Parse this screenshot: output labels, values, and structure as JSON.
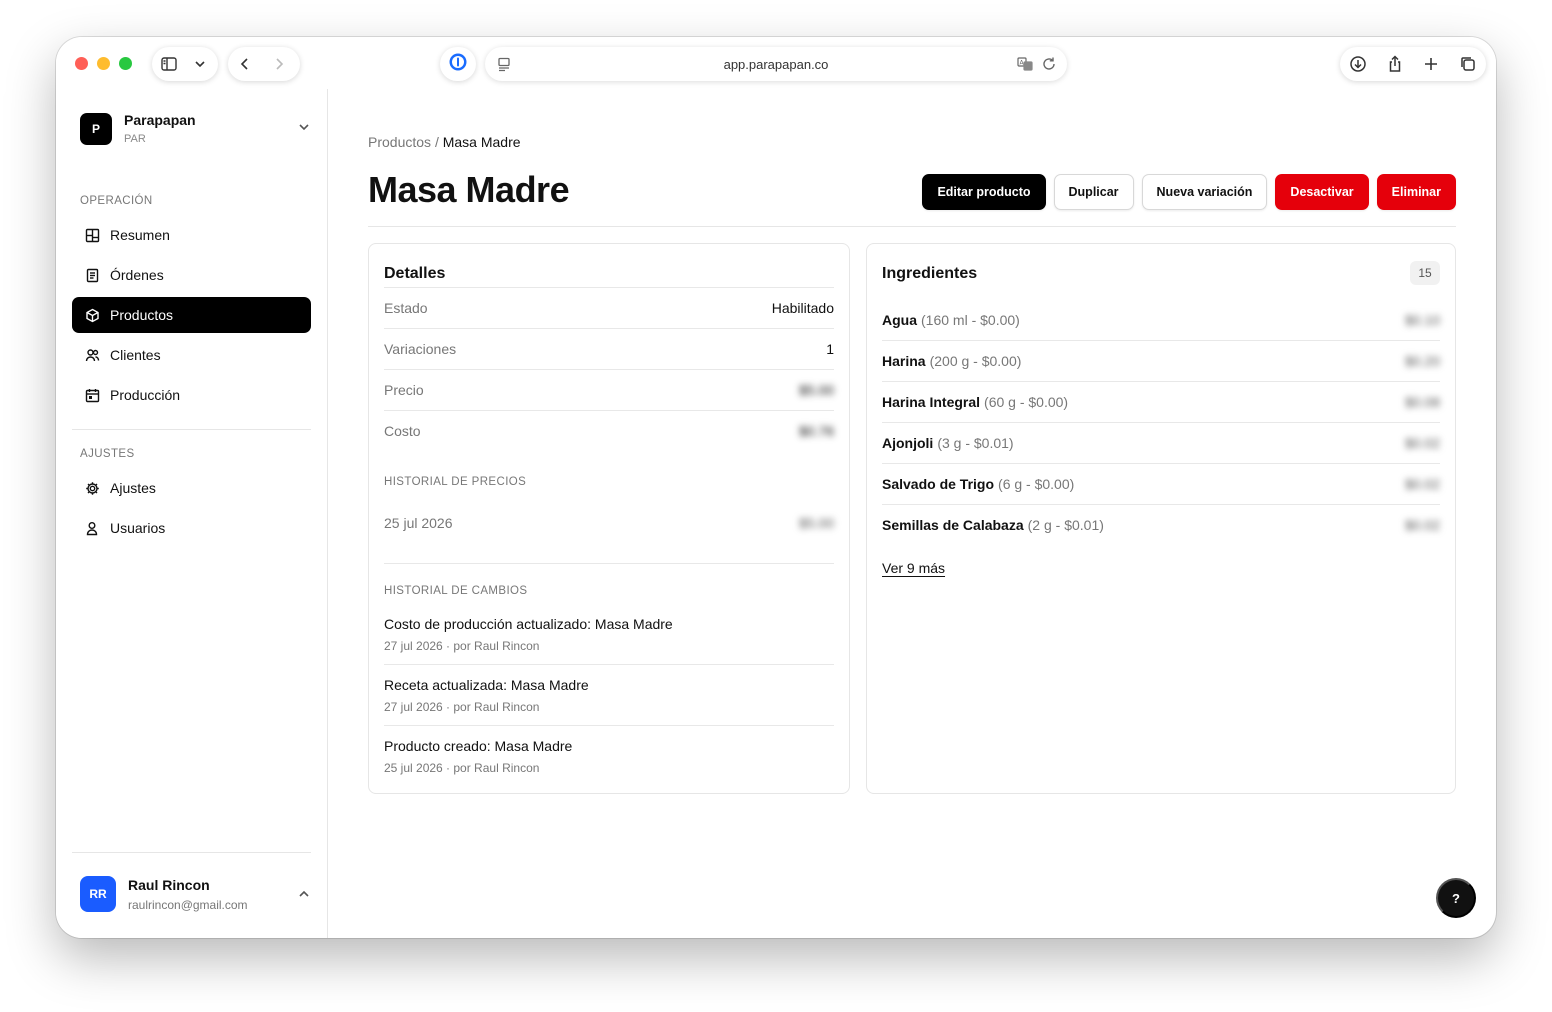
{
  "browser": {
    "url": "app.parapapan.co"
  },
  "sidebar": {
    "org": {
      "logo_letter": "P",
      "name": "Parapapan",
      "code": "PAR"
    },
    "section_operacion": "OPERACIÓN",
    "operacion_items": [
      {
        "label": "Resumen",
        "icon": "dashboard-icon"
      },
      {
        "label": "Órdenes",
        "icon": "document-icon"
      },
      {
        "label": "Productos",
        "icon": "box-icon",
        "active": true
      },
      {
        "label": "Clientes",
        "icon": "users-icon"
      },
      {
        "label": "Producción",
        "icon": "calendar-icon"
      }
    ],
    "section_ajustes": "AJUSTES",
    "ajustes_items": [
      {
        "label": "Ajustes",
        "icon": "gear-icon"
      },
      {
        "label": "Usuarios",
        "icon": "user-icon"
      }
    ],
    "user": {
      "initials": "RR",
      "name": "Raul Rincon",
      "email": "raulrincon@gmail.com"
    }
  },
  "page": {
    "breadcrumb_parent": "Productos",
    "breadcrumb_sep": "/",
    "breadcrumb_current": "Masa Madre",
    "title": "Masa Madre",
    "actions": {
      "edit": "Editar producto",
      "duplicate": "Duplicar",
      "new_variation": "Nueva variación",
      "deactivate": "Desactivar",
      "delete": "Eliminar"
    }
  },
  "details": {
    "title": "Detalles",
    "rows": [
      {
        "key": "Estado",
        "value": "Habilitado",
        "blurred": false
      },
      {
        "key": "Variaciones",
        "value": "1",
        "blurred": false
      },
      {
        "key": "Precio",
        "value": "$5.00",
        "blurred": true
      },
      {
        "key": "Costo",
        "value": "$0.76",
        "blurred": true
      }
    ],
    "price_history_label": "HISTORIAL DE PRECIOS",
    "price_history": [
      {
        "date": "25 jul 2026",
        "value": "$5.00"
      }
    ],
    "change_history_label": "HISTORIAL DE CAMBIOS",
    "changes": [
      {
        "title": "Costo de producción actualizado: Masa Madre",
        "meta": "27 jul 2026 · por Raul Rincon"
      },
      {
        "title": "Receta actualizada: Masa Madre",
        "meta": "27 jul 2026 · por Raul Rincon"
      },
      {
        "title": "Producto creado: Masa Madre",
        "meta": "25 jul 2026 · por Raul Rincon"
      }
    ]
  },
  "ingredients": {
    "title": "Ingredientes",
    "count": "15",
    "items": [
      {
        "name": "Agua",
        "detail": "(160 ml - $0.00)",
        "value": "$0.10"
      },
      {
        "name": "Harina",
        "detail": "(200 g - $0.00)",
        "value": "$0.20"
      },
      {
        "name": "Harina Integral",
        "detail": "(60 g - $0.00)",
        "value": "$0.08"
      },
      {
        "name": "Ajonjoli",
        "detail": "(3 g - $0.01)",
        "value": "$0.02"
      },
      {
        "name": "Salvado de Trigo",
        "detail": "(6 g - $0.00)",
        "value": "$0.02"
      },
      {
        "name": "Semillas de Calabaza",
        "detail": "(2 g - $0.01)",
        "value": "$0.02"
      }
    ],
    "more_link": "Ver 9 más"
  },
  "help_label": "?",
  "colors": {
    "accent_dark": "#000000",
    "danger": "#e5000b",
    "avatar": "#1a5cff"
  }
}
